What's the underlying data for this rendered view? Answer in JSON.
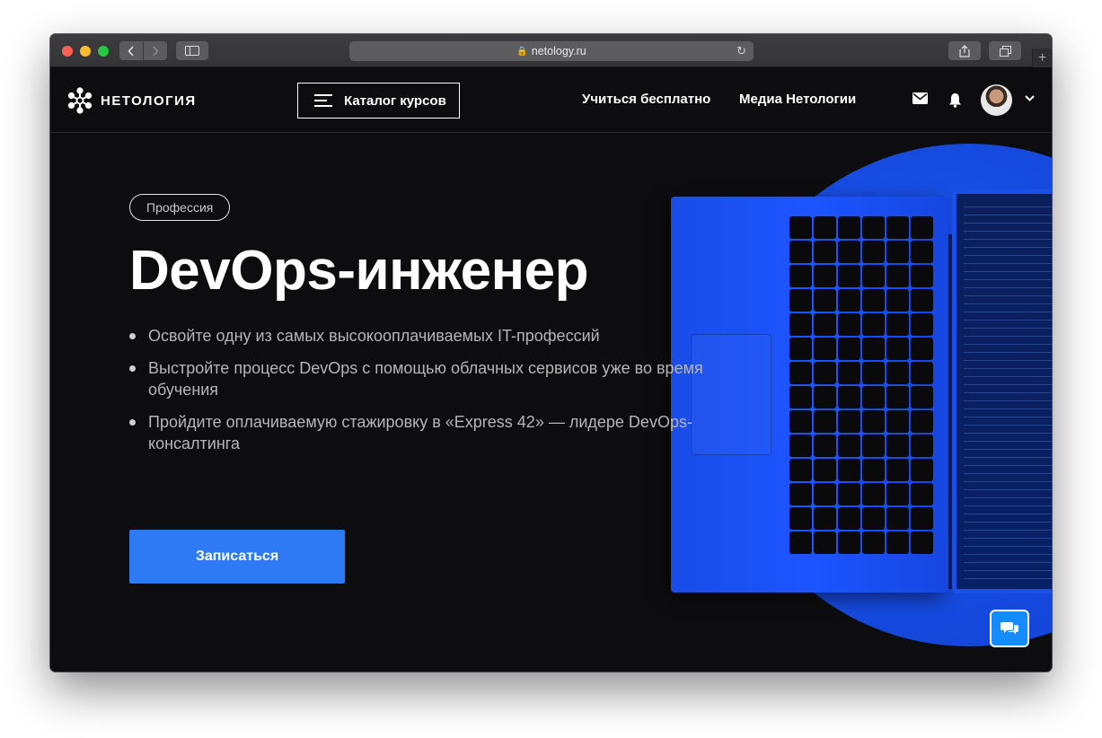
{
  "browser": {
    "url": "netology.ru",
    "new_tab_symbol": "+"
  },
  "header": {
    "logo_text": "НЕТОЛОГИЯ",
    "catalog_button": "Каталог курсов",
    "nav": {
      "learn_free": "Учиться бесплатно",
      "media": "Медиа Нетологии"
    },
    "icons": [
      "mail-icon",
      "bell-icon",
      "avatar",
      "chevron-down-icon"
    ]
  },
  "hero": {
    "badge": "Профессия",
    "title": "DevOps-инженер",
    "bullets": [
      "Освойте одну из самых высокооплачиваемых IT-профессий",
      "Выстройте процесс DevOps с помощью облачных сервисов уже во время обучения",
      "Пройдите оплачиваемую стажировку в «Express 42» — лидере DevOps-консалтинга"
    ],
    "cta": "Записаться"
  },
  "colors": {
    "background": "#0d0d0f",
    "accent": "#2e7af5",
    "circle": "#1a52f0",
    "chat": "#148cff"
  }
}
